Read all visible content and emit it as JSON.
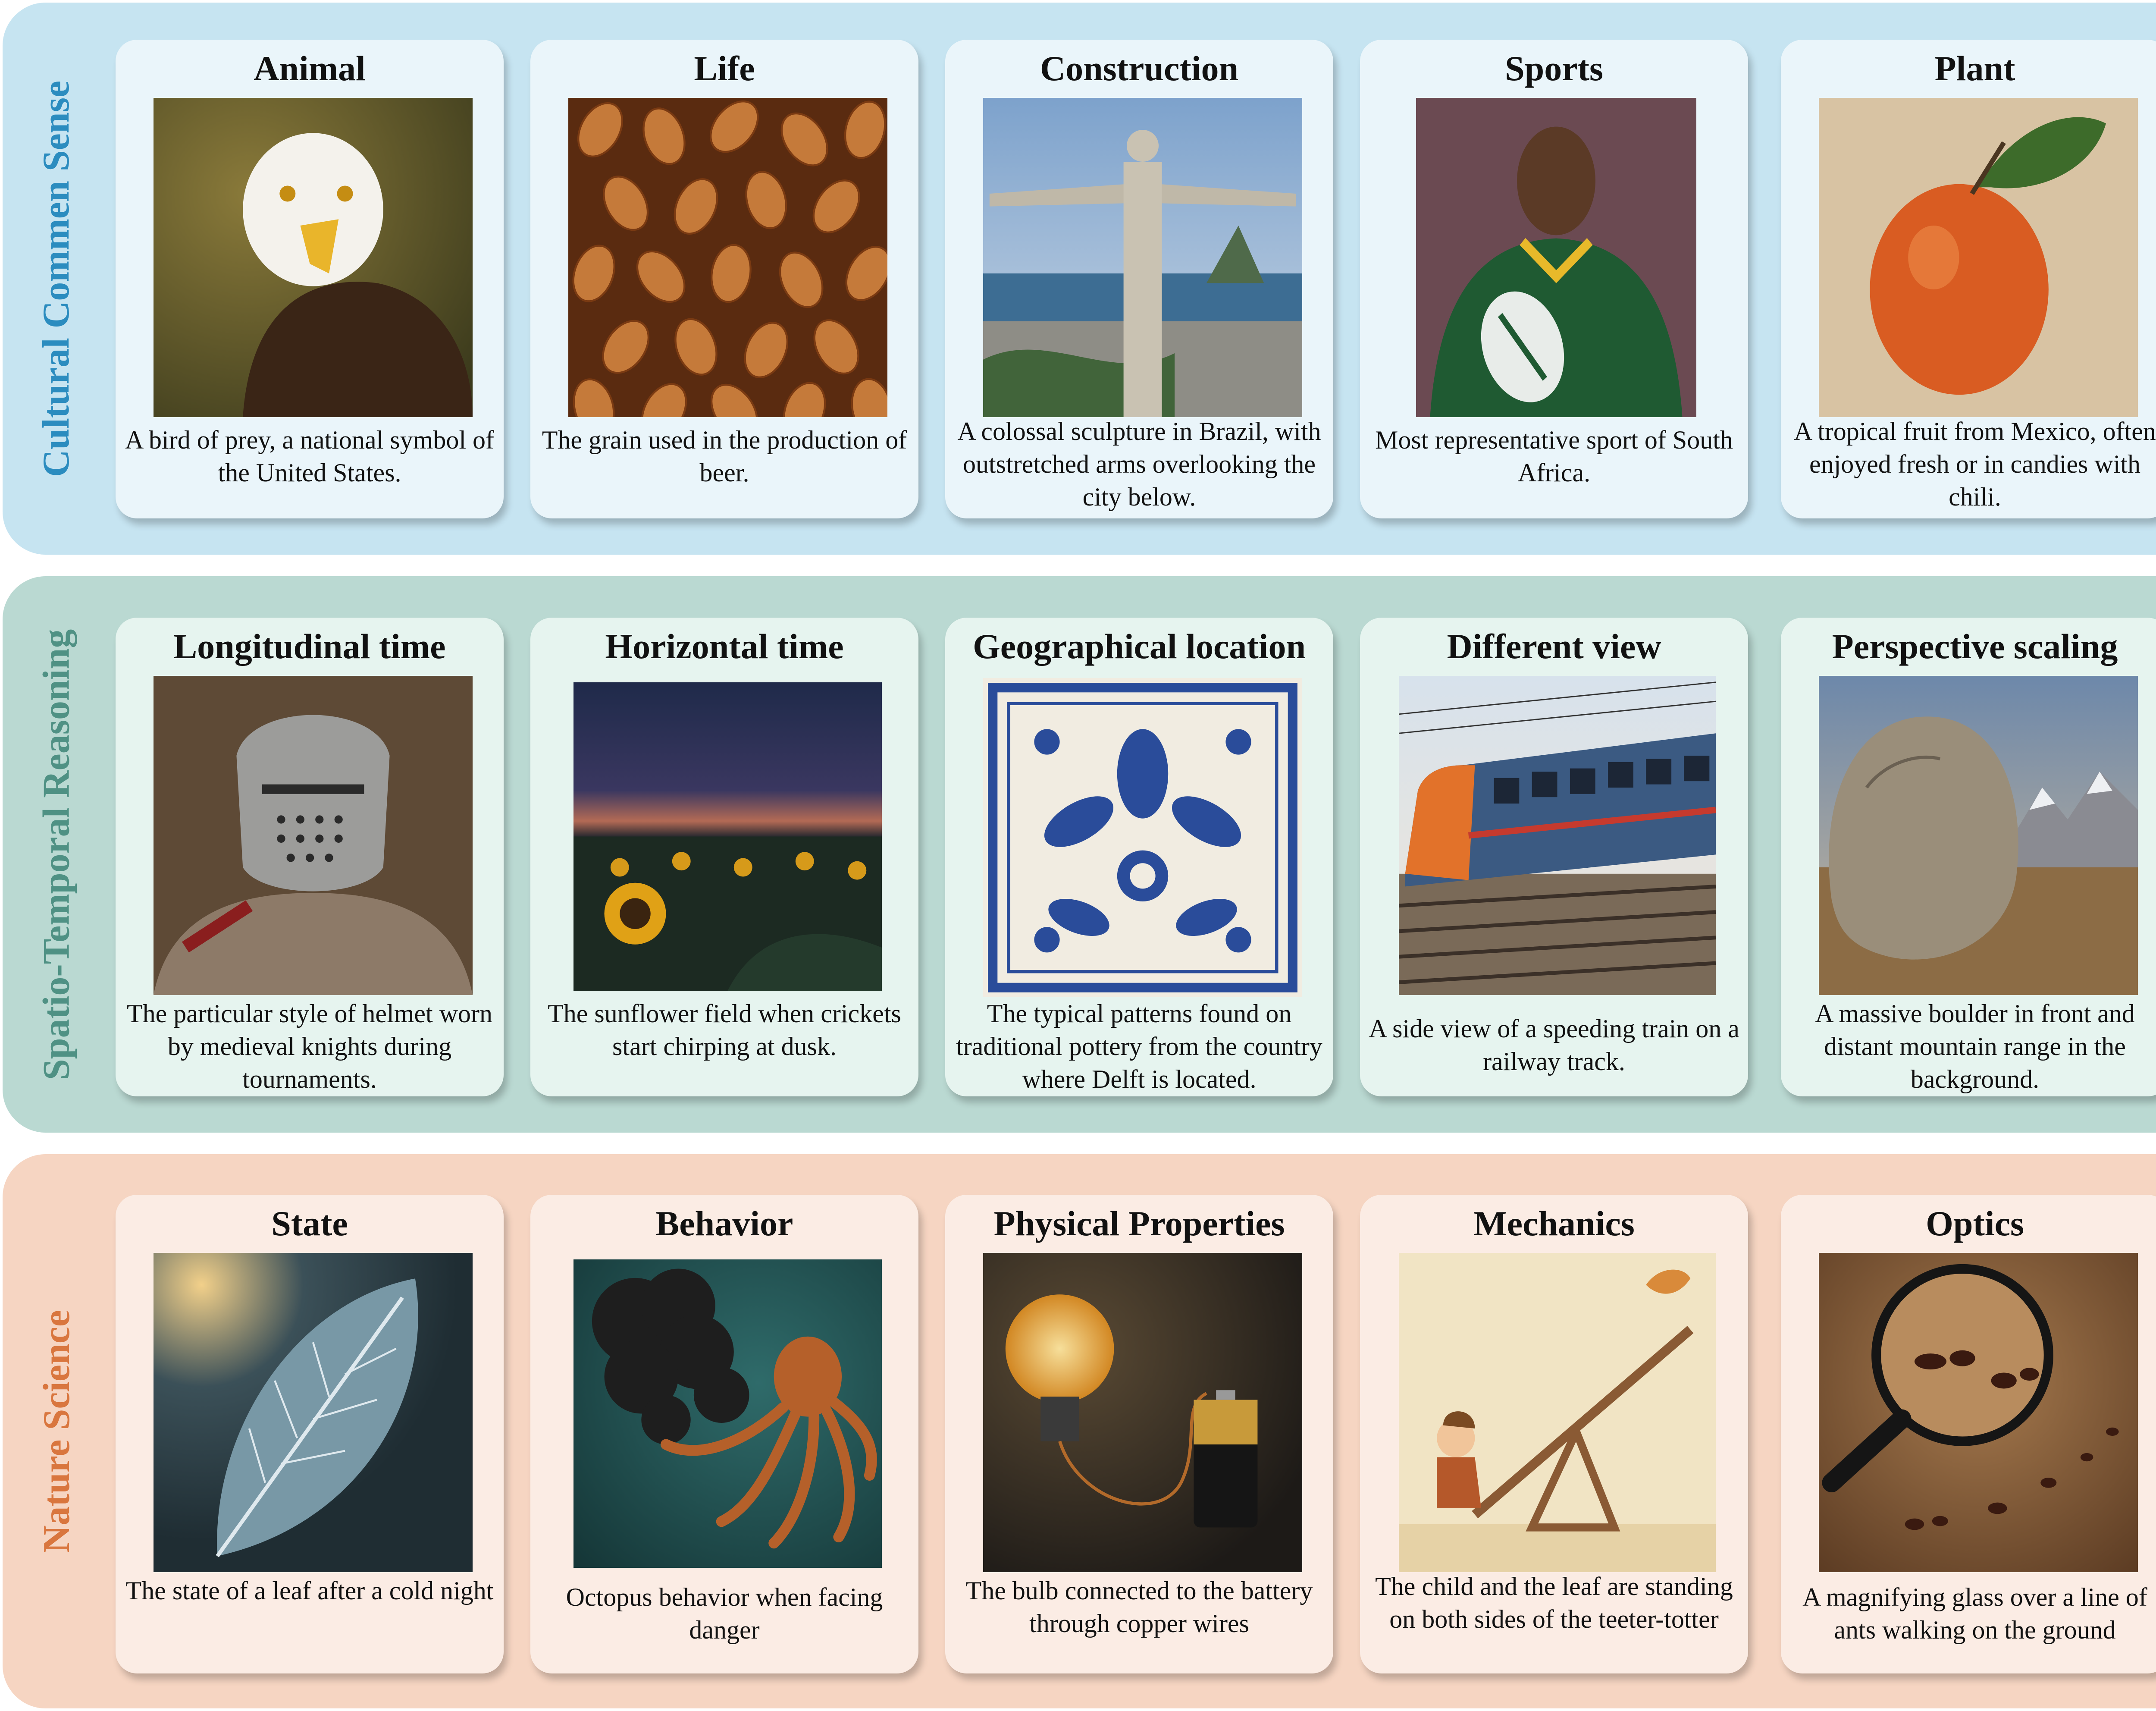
{
  "rows": [
    {
      "label": "Cultural Commen Sense",
      "label_color": "#2b8cbf",
      "band_color": "#c6e4f1",
      "card_color": "#eaf5fa",
      "cards": [
        {
          "title": "Animal",
          "icon": "bald-eagle-image",
          "caption": "A bird of prey, a national symbol of the United States."
        },
        {
          "title": "Life",
          "icon": "barley-grains-image",
          "caption": "The grain used in the production of beer."
        },
        {
          "title": "Construction",
          "icon": "christ-the-redeemer-image",
          "caption": "A colossal sculpture in Brazil, with outstretched arms overlooking the city below."
        },
        {
          "title": "Sports",
          "icon": "rugby-player-image",
          "caption": "Most representative sport of South Africa."
        },
        {
          "title": "Plant",
          "icon": "tropical-fruit-image",
          "caption": "A tropical fruit from Mexico, often enjoyed fresh or in candies with chili."
        }
      ]
    },
    {
      "label": "Spatio-Temporal Reasoning",
      "label_color": "#4f9184",
      "band_color": "#bad9d2",
      "card_color": "#e6f4ef",
      "cards": [
        {
          "title": "Longitudinal time",
          "icon": "knight-helmet-image",
          "caption": "The particular style of helmet worn by medieval knights during tournaments."
        },
        {
          "title": "Horizontal time",
          "icon": "sunflower-field-dusk-image",
          "caption": "The sunflower field when crickets start chirping at dusk."
        },
        {
          "title": "Geographical location",
          "icon": "delft-blue-tile-image",
          "caption": "The typical patterns found on traditional pottery from the country where Delft is located."
        },
        {
          "title": "Different view",
          "icon": "speeding-train-image",
          "caption": "A side view of a speeding train on a railway track."
        },
        {
          "title": "Perspective scaling",
          "icon": "boulder-mountains-image",
          "caption": "A massive boulder in front and distant mountain range in the background."
        }
      ]
    },
    {
      "label": "Nature Science",
      "label_color": "#d9763e",
      "band_color": "#f6d5c2",
      "card_color": "#fbece4",
      "cards": [
        {
          "title": "State",
          "icon": "frosted-leaf-image",
          "caption": "The state of a leaf after a cold night"
        },
        {
          "title": "Behavior",
          "icon": "octopus-ink-image",
          "caption": "Octopus behavior when facing danger"
        },
        {
          "title": "Physical Properties",
          "icon": "lightbulb-battery-image",
          "caption": "The bulb connected to the battery through copper wires"
        },
        {
          "title": "Mechanics",
          "icon": "seesaw-child-leaf-image",
          "caption": "The child and the leaf are standing on both sides of the teeter-totter"
        },
        {
          "title": "Optics",
          "icon": "magnifying-glass-ants-image",
          "caption": "A magnifying glass over a line of ants walking on the ground"
        }
      ]
    }
  ]
}
